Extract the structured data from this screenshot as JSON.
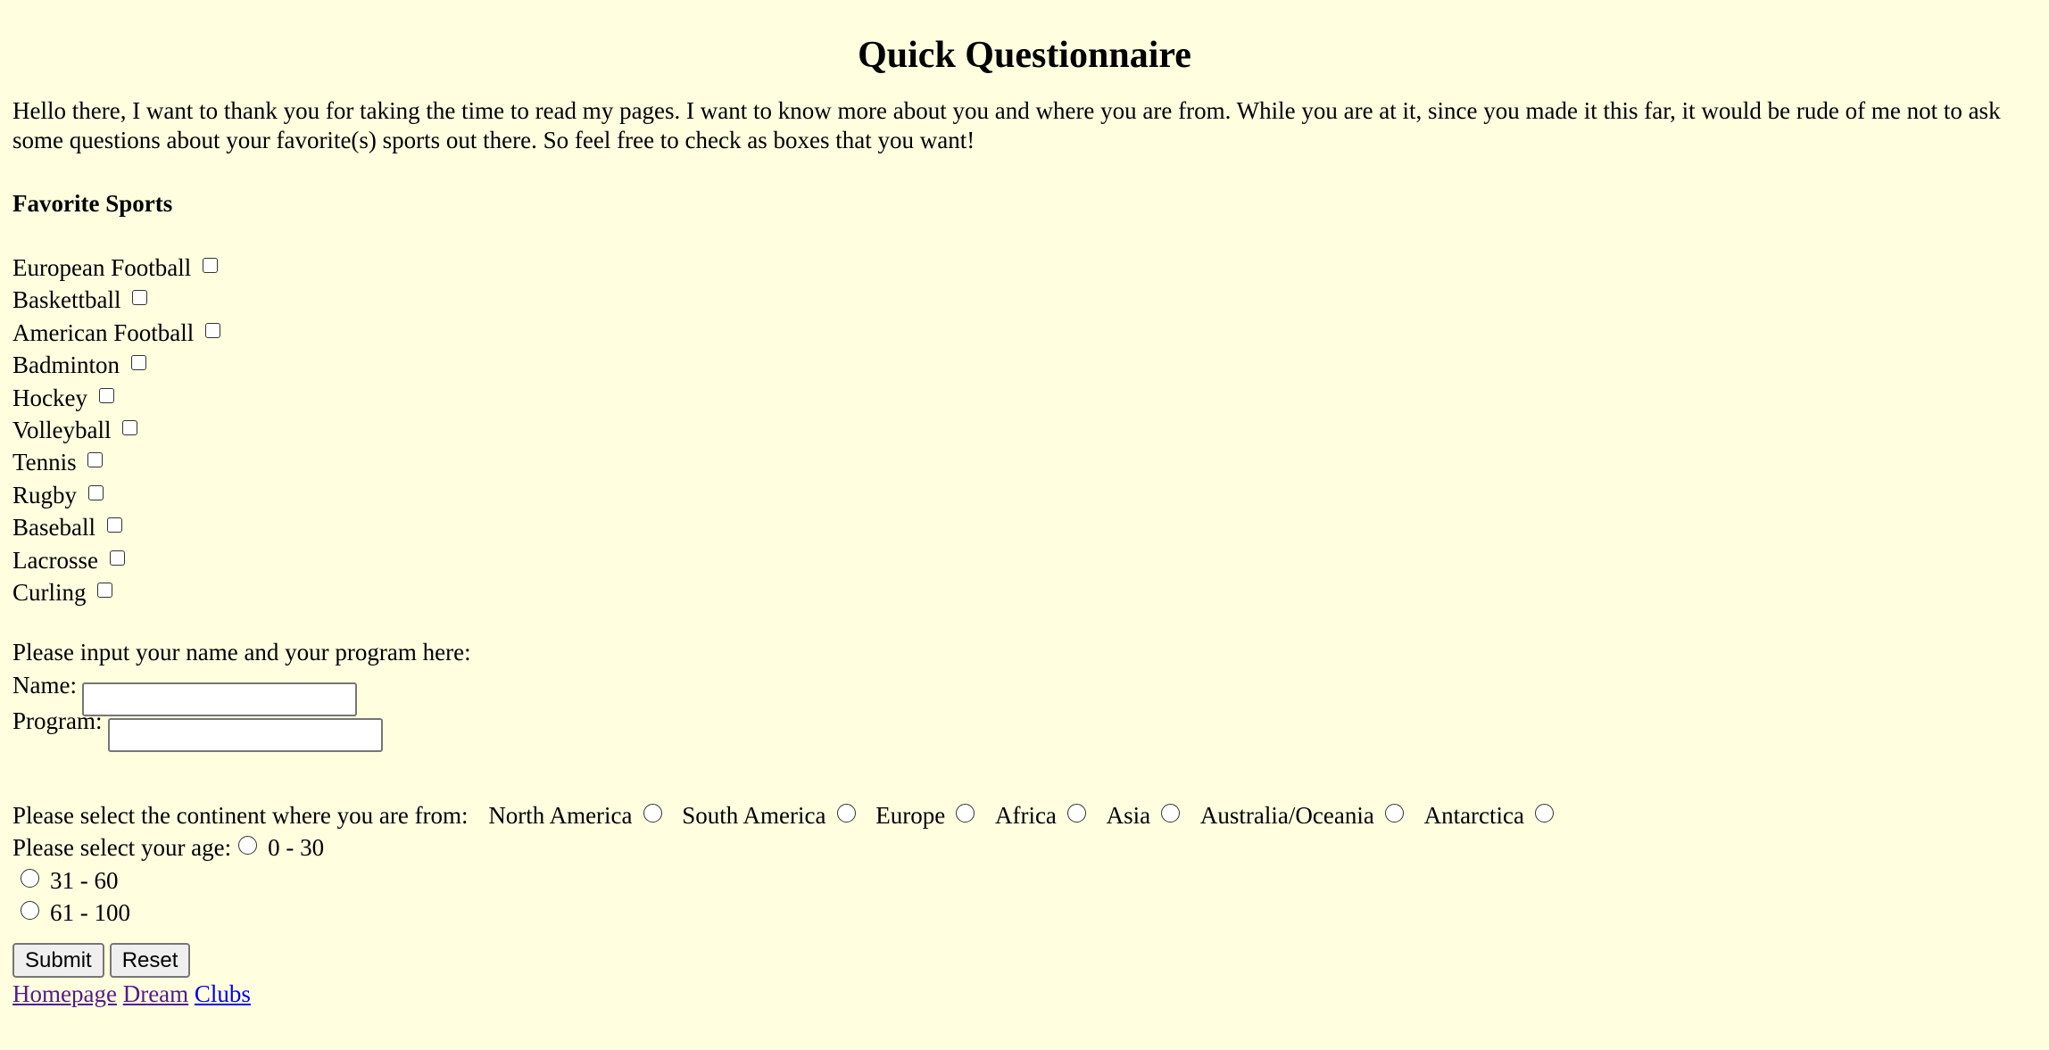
{
  "title": "Quick Questionnaire",
  "intro": "Hello there, I want to thank you for taking the time to read my pages. I want to know more about you and where you are from. While you are at it, since you made it this far, it would be rude of me not to ask some questions about your favorite(s) sports out there. So feel free to check as boxes that you want!",
  "sports_heading": "Favorite Sports",
  "sports": [
    {
      "label": "European Football",
      "checked": false
    },
    {
      "label": "Baskettball",
      "checked": false
    },
    {
      "label": "American Football",
      "checked": false
    },
    {
      "label": "Badminton",
      "checked": false
    },
    {
      "label": "Hockey",
      "checked": false
    },
    {
      "label": "Volleyball",
      "checked": false
    },
    {
      "label": "Tennis",
      "checked": false
    },
    {
      "label": "Rugby",
      "checked": false
    },
    {
      "label": "Baseball",
      "checked": false
    },
    {
      "label": "Lacrosse",
      "checked": false
    },
    {
      "label": "Curling",
      "checked": false
    }
  ],
  "name_prompt": "Please input your name and your program here:",
  "fields": {
    "name_label": "Name:",
    "name_value": "",
    "program_label": "Program:",
    "program_value": ""
  },
  "continent": {
    "prompt": "Please select the continent where you are from:",
    "options": [
      "North America",
      "South America",
      "Europe",
      "Africa",
      "Asia",
      "Australia/Oceania",
      "Antarctica"
    ]
  },
  "age": {
    "prompt": "Please select your age:",
    "options": [
      "0 - 30",
      "31 - 60",
      "61 - 100"
    ]
  },
  "buttons": {
    "submit": "Submit",
    "reset": "Reset"
  },
  "links": [
    {
      "label": "Homepage",
      "visited": true
    },
    {
      "label": "Dream",
      "visited": true
    },
    {
      "label": "Clubs",
      "visited": false
    }
  ]
}
